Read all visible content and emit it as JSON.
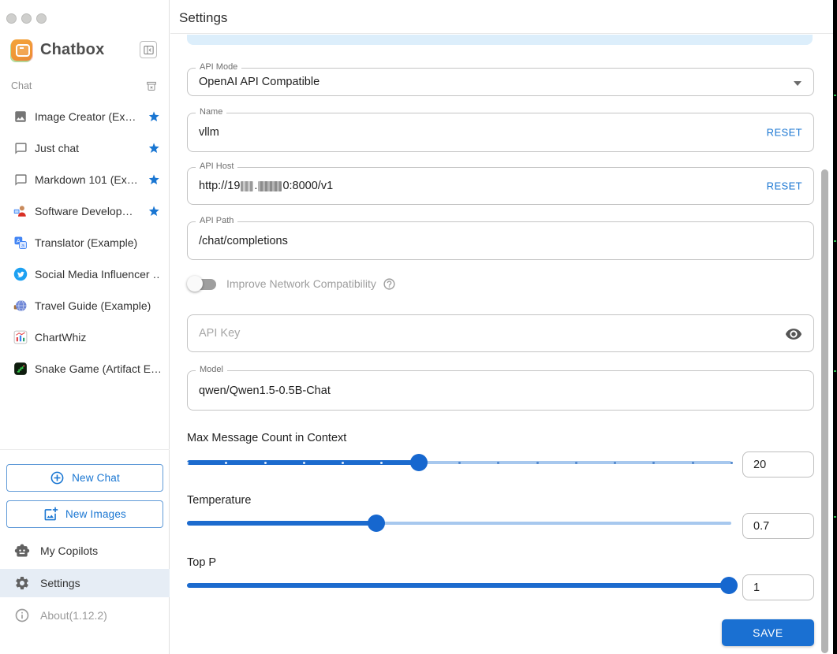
{
  "window": {
    "traffic_lights": [
      "close",
      "minimize",
      "zoom"
    ]
  },
  "sidebar": {
    "app_title": "Chatbox",
    "collapse_icon": "collapse-sidebar-icon",
    "section_label": "Chat",
    "section_icon": "clear-archive-icon",
    "sessions": [
      {
        "label": "Image Creator (Ex…",
        "icon": "image-icon",
        "starred": true
      },
      {
        "label": "Just chat",
        "icon": "chat-bubble-icon",
        "starred": true
      },
      {
        "label": "Markdown 101 (Ex…",
        "icon": "chat-bubble-icon",
        "starred": true
      },
      {
        "label": "Software Develop…",
        "icon": "developer-icon",
        "starred": true
      },
      {
        "label": "Translator (Example)",
        "icon": "translate-icon",
        "starred": false
      },
      {
        "label": "Social Media Influencer …",
        "icon": "twitter-icon",
        "starred": false
      },
      {
        "label": "Travel Guide (Example)",
        "icon": "globe-icon",
        "starred": false
      },
      {
        "label": "ChartWhiz",
        "icon": "chart-icon",
        "starred": false
      },
      {
        "label": "Snake Game (Artifact E…",
        "icon": "snake-game-icon",
        "starred": false
      }
    ],
    "new_chat_label": "New Chat",
    "new_images_label": "New Images",
    "my_copilots_label": "My Copilots",
    "settings_label": "Settings",
    "about_label": "About(1.12.2)"
  },
  "header": {
    "title": "Settings"
  },
  "form": {
    "api_mode": {
      "label": "API Mode",
      "value": "OpenAI API Compatible"
    },
    "name": {
      "label": "Name",
      "value": "vllm",
      "reset_label": "RESET"
    },
    "api_host": {
      "label": "API Host",
      "value_prefix": "http://19",
      "value_mid": ".",
      "value_suffix": "0:8000/v1",
      "redacted": true,
      "reset_label": "RESET"
    },
    "api_path": {
      "label": "API Path",
      "value": "/chat/completions"
    },
    "network_toggle": {
      "label": "Improve Network Compatibility",
      "enabled": false,
      "help_icon": "help-circle-icon"
    },
    "api_key": {
      "placeholder": "API Key",
      "visibility_icon": "eye-icon"
    },
    "model": {
      "label": "Model",
      "value": "qwen/Qwen1.5-0.5B-Chat"
    },
    "sliders": [
      {
        "label": "Max Message Count in Context",
        "value": "20",
        "percent": 42.6,
        "marks": 15
      },
      {
        "label": "Temperature",
        "value": "0.7",
        "percent": 34.8,
        "marks": 0
      },
      {
        "label": "Top P",
        "value": "1",
        "percent": 99.5,
        "marks": 0
      }
    ],
    "save_label": "SAVE"
  },
  "colors": {
    "accent_blue": "#1976d2",
    "save_button": "#1a70d2",
    "slider_fill": "#1c6bce",
    "slider_rail": "#a7c8ee",
    "selected_row_bg": "#e6edf5",
    "info_bar": "#dceefb",
    "logo_orange": "#ef9434",
    "twitter_blue": "#1da1f2",
    "star_blue": "#1976d2"
  }
}
